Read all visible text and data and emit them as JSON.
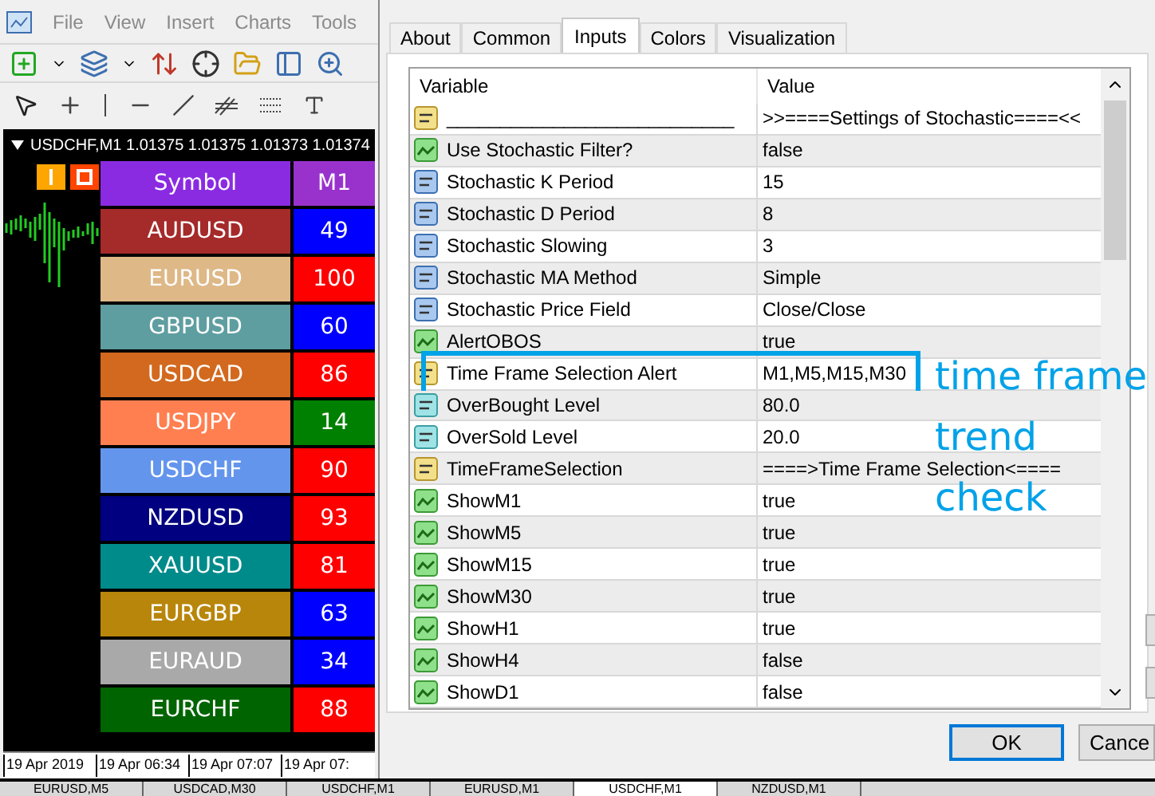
{
  "terminal": {
    "menu": [
      "File",
      "View",
      "Insert",
      "Charts",
      "Tools"
    ],
    "chart": {
      "header": "USDCHF,M1  1.01375 1.01375 1.01373 1.01374",
      "table": {
        "columns": [
          {
            "label": "Symbol",
            "color": "#8a2be2"
          },
          {
            "label": "M1",
            "color": "#9932cc"
          }
        ],
        "rows": [
          {
            "cells": [
              {
                "text": "AUDUSD",
                "color": "#a52a2a"
              },
              {
                "text": "49",
                "color": "#0000ff"
              }
            ]
          },
          {
            "cells": [
              {
                "text": "EURUSD",
                "color": "#deb887"
              },
              {
                "text": "100",
                "color": "#ff0000"
              }
            ]
          },
          {
            "cells": [
              {
                "text": "GBPUSD",
                "color": "#5f9ea0"
              },
              {
                "text": "60",
                "color": "#0000ff"
              }
            ]
          },
          {
            "cells": [
              {
                "text": "USDCAD",
                "color": "#d2691e"
              },
              {
                "text": "86",
                "color": "#ff0000"
              }
            ]
          },
          {
            "cells": [
              {
                "text": "USDJPY",
                "color": "#ff7f50"
              },
              {
                "text": "14",
                "color": "#008000"
              }
            ]
          },
          {
            "cells": [
              {
                "text": "USDCHF",
                "color": "#6495ed"
              },
              {
                "text": "90",
                "color": "#ff0000"
              }
            ]
          },
          {
            "cells": [
              {
                "text": "NZDUSD",
                "color": "#000080"
              },
              {
                "text": "93",
                "color": "#ff0000"
              }
            ]
          },
          {
            "cells": [
              {
                "text": "XAUUSD",
                "color": "#008b8b"
              },
              {
                "text": "81",
                "color": "#ff0000"
              }
            ]
          },
          {
            "cells": [
              {
                "text": "EURGBP",
                "color": "#b8860b"
              },
              {
                "text": "63",
                "color": "#0000ff"
              }
            ]
          },
          {
            "cells": [
              {
                "text": "EURAUD",
                "color": "#a9a9a9"
              },
              {
                "text": "34",
                "color": "#0000ff"
              }
            ]
          },
          {
            "cells": [
              {
                "text": "EURCHF",
                "color": "#006400"
              },
              {
                "text": "88",
                "color": "#ff0000"
              }
            ]
          }
        ]
      },
      "time_axis": [
        "19 Apr 2019",
        "19 Apr 06:34",
        "19 Apr 07:07",
        "19 Apr 07:"
      ]
    },
    "chart_tabs": [
      {
        "label": "EURUSD,M5",
        "selected": false
      },
      {
        "label": "USDCAD,M30",
        "selected": false
      },
      {
        "label": "USDCHF,M1",
        "selected": false
      },
      {
        "label": "EURUSD,M1",
        "selected": false
      },
      {
        "label": "USDCHF,M1",
        "selected": true
      },
      {
        "label": "NZDUSD,M1",
        "selected": false
      }
    ]
  },
  "dialog": {
    "tabs": [
      {
        "label": "About",
        "selected": false
      },
      {
        "label": "Common",
        "selected": false
      },
      {
        "label": "Inputs",
        "selected": true
      },
      {
        "label": "Colors",
        "selected": false
      },
      {
        "label": "Visualization",
        "selected": false
      }
    ],
    "columns": [
      "Variable",
      "Value"
    ],
    "rows": [
      {
        "kind": "string",
        "variable": "___________________________",
        "value": ">>====Settings of Stochastic====<<",
        "highlighted": false
      },
      {
        "kind": "bool",
        "variable": "Use Stochastic Filter?",
        "value": "false",
        "highlighted": false
      },
      {
        "kind": "int",
        "variable": "Stochastic K Period",
        "value": "15",
        "highlighted": false
      },
      {
        "kind": "int",
        "variable": "Stochastic D Period",
        "value": "8",
        "highlighted": false
      },
      {
        "kind": "int",
        "variable": "Stochastic Slowing",
        "value": "3",
        "highlighted": false
      },
      {
        "kind": "int",
        "variable": "Stochastic MA Method",
        "value": "Simple",
        "highlighted": false
      },
      {
        "kind": "int",
        "variable": "Stochastic Price Field",
        "value": "Close/Close",
        "highlighted": false
      },
      {
        "kind": "bool",
        "variable": "AlertOBOS",
        "value": "true",
        "highlighted": false
      },
      {
        "kind": "string",
        "variable": "Time Frame Selection Alert",
        "value": "M1,M5,M15,M30",
        "highlighted": true
      },
      {
        "kind": "double",
        "variable": "OverBought Level",
        "value": "80.0",
        "highlighted": false
      },
      {
        "kind": "double",
        "variable": "OverSold Level",
        "value": "20.0",
        "highlighted": false
      },
      {
        "kind": "string",
        "variable": "TimeFrameSelection",
        "value": "====>Time Frame Selection<====",
        "highlighted": false
      },
      {
        "kind": "bool",
        "variable": "ShowM1",
        "value": "true",
        "highlighted": false
      },
      {
        "kind": "bool",
        "variable": "ShowM5",
        "value": "true",
        "highlighted": false
      },
      {
        "kind": "bool",
        "variable": "ShowM15",
        "value": "true",
        "highlighted": false
      },
      {
        "kind": "bool",
        "variable": "ShowM30",
        "value": "true",
        "highlighted": false
      },
      {
        "kind": "bool",
        "variable": "ShowH1",
        "value": "true",
        "highlighted": false
      },
      {
        "kind": "bool",
        "variable": "ShowH4",
        "value": "false",
        "highlighted": false
      },
      {
        "kind": "bool",
        "variable": "ShowD1",
        "value": "false",
        "highlighted": false
      }
    ],
    "annotations": [
      "time frame",
      "trend",
      "check"
    ],
    "buttons": [
      "OK",
      "Cance"
    ]
  }
}
